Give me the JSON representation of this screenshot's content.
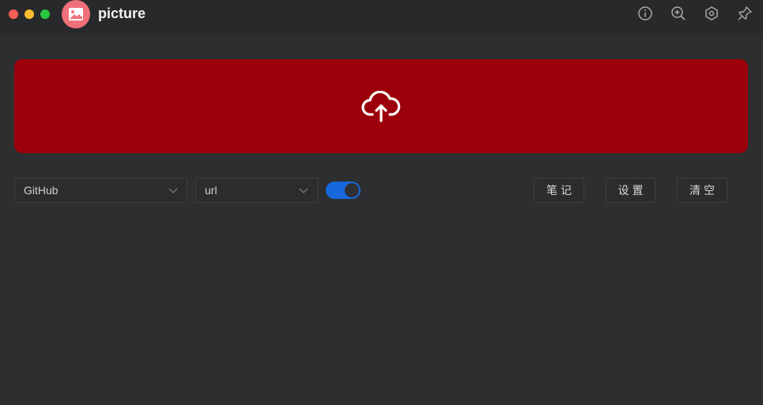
{
  "window": {
    "title": "picture",
    "controls": [
      "close",
      "minimize",
      "maximize"
    ]
  },
  "toolbar": {
    "icons": [
      "info-icon",
      "zoom-in-icon",
      "settings-hex-icon",
      "pin-icon"
    ]
  },
  "upload": {
    "icon": "cloud-upload-icon"
  },
  "controls": {
    "source": {
      "value": "GitHub"
    },
    "format": {
      "value": "url"
    },
    "toggle": {
      "checked": true
    },
    "notes_label": "笔记",
    "settings_label": "设置",
    "clear_label": "清空"
  },
  "colors": {
    "upload_bg": "#9c000b",
    "toggle_on": "#1668dc",
    "logo_bg": "#f07079"
  }
}
